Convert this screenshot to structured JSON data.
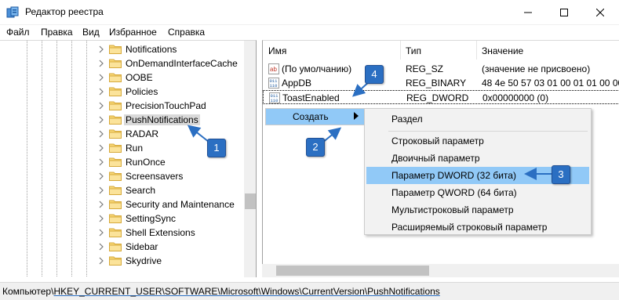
{
  "window": {
    "title": "Редактор реестра",
    "icon": "regedit-icon"
  },
  "menubar": {
    "items": [
      "Файл",
      "Правка",
      "Вид",
      "Избранное",
      "Справка"
    ]
  },
  "tree": {
    "items": [
      {
        "label": "Notifications"
      },
      {
        "label": "OnDemandInterfaceCache"
      },
      {
        "label": "OOBE"
      },
      {
        "label": "Policies"
      },
      {
        "label": "PrecisionTouchPad"
      },
      {
        "label": "PushNotifications",
        "selected": true
      },
      {
        "label": "RADAR"
      },
      {
        "label": "Run"
      },
      {
        "label": "RunOnce"
      },
      {
        "label": "Screensavers"
      },
      {
        "label": "Search"
      },
      {
        "label": "Security and Maintenance"
      },
      {
        "label": "SettingSync"
      },
      {
        "label": "Shell Extensions"
      },
      {
        "label": "Sidebar"
      },
      {
        "label": "Skydrive"
      }
    ]
  },
  "list": {
    "columns": [
      "Имя",
      "Тип",
      "Значение"
    ],
    "rows": [
      {
        "icon": "string-value-icon",
        "name": "(По умолчанию)",
        "type": "REG_SZ",
        "value": "(значение не присвоено)"
      },
      {
        "icon": "binary-value-icon",
        "name": "AppDB",
        "type": "REG_BINARY",
        "value": "48 4e 50 57 03 01 00 01 01 00 00 0"
      },
      {
        "icon": "binary-value-icon",
        "name": "ToastEnabled",
        "type": "REG_DWORD",
        "value": "0x00000000 (0)"
      }
    ]
  },
  "context_menu": {
    "create_label": "Создать"
  },
  "submenu": {
    "items": [
      "Раздел",
      "Строковый параметр",
      "Двоичный параметр",
      "Параметр DWORD (32 бита)",
      "Параметр QWORD (64 бита)",
      "Мультистроковый параметр",
      "Расширяемый строковый параметр"
    ],
    "highlighted": "Параметр DWORD (32 бита)"
  },
  "status": {
    "prefix": "Компьютер\\",
    "path": "HKEY_CURRENT_USER\\SOFTWARE\\Microsoft\\Windows\\CurrentVersion\\PushNotifications"
  },
  "annotations": {
    "badges": [
      "1",
      "2",
      "3",
      "4"
    ],
    "color": "#2b6fc2"
  }
}
